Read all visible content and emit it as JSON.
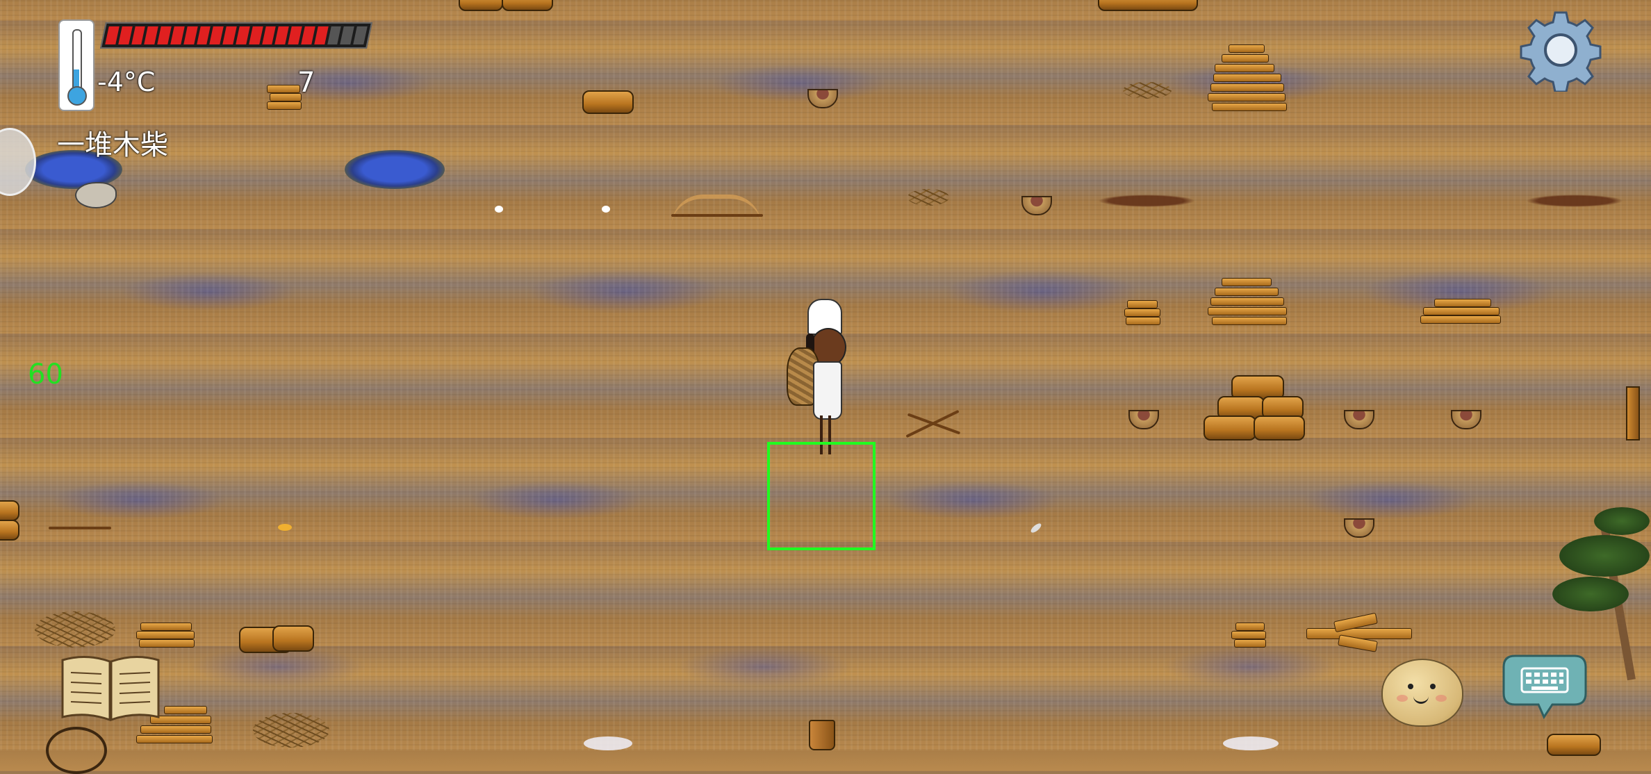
{
  "hud": {
    "temperature": "-4°C",
    "count": "7",
    "held_item": "一堆木柴",
    "fps": "60",
    "health_filled_segments": 17,
    "health_total_segments": 20
  },
  "icons": {
    "thermometer": "thermometer-icon",
    "settings": "gear-icon",
    "recipe_book": "book-icon",
    "emote": "face-icon",
    "chat": "keyboard-icon"
  },
  "colors": {
    "health": "#e02020",
    "selection": "#20ff20",
    "fps": "#22e022"
  }
}
